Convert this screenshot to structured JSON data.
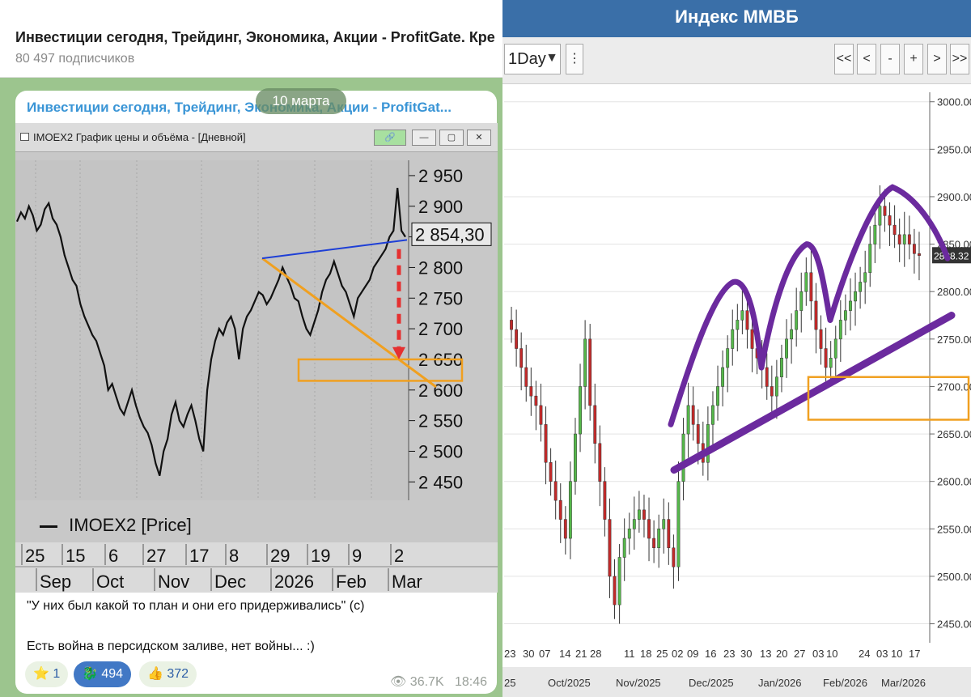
{
  "telegram": {
    "header_title": "Инвестиции сегодня, Трейдинг, Экономика, Акции - ProfitGate. Кре",
    "subscribers": "80 497 подписчиков",
    "channel_name": "Инвестиции сегодня, Трейдинг, Экономика, Акции - ProfitGat...",
    "date_pill": "10 марта",
    "window_title": "IMOEX2 График цены и объёма - [Дневной]",
    "text_line1": "\"У них был какой то план и они его придерживались\" (с)",
    "text_line2": "Есть война в персидском заливе, нет войны... :)",
    "reactions": [
      {
        "emoji": "⭐",
        "count": "1"
      },
      {
        "emoji": "🐉",
        "count": "494"
      },
      {
        "emoji": "👍",
        "count": "372"
      }
    ],
    "views": "36.7K",
    "time": "18:46"
  },
  "right_panel": {
    "title": "Индекс ММВБ",
    "period": "1Day",
    "nav_buttons": [
      "<<",
      "<",
      "-",
      "+",
      ">",
      ">>"
    ]
  },
  "chart_data": [
    {
      "type": "line",
      "title": "",
      "legend": "IMOEX2 [Price]",
      "y_ticks": [
        "2 950",
        "2 900",
        "2 850",
        "2 800",
        "2 750",
        "2 700",
        "2 650",
        "2 600",
        "2 550",
        "2 500",
        "2 450"
      ],
      "ylim": [
        2420,
        2975
      ],
      "last_price_label": "2 854,30",
      "x_day_labels": [
        "25",
        "15",
        "6",
        "27",
        "17",
        "8",
        "29",
        "19",
        "9",
        "2"
      ],
      "x_month_labels": [
        "Sep",
        "Oct",
        "Nov",
        "Dec",
        "2026",
        "Feb",
        "Mar"
      ],
      "series": [
        {
          "values": [
            2875,
            2890,
            2880,
            2900,
            2885,
            2860,
            2870,
            2895,
            2905,
            2880,
            2870,
            2850,
            2820,
            2800,
            2780,
            2770,
            2740,
            2720,
            2705,
            2690,
            2680,
            2660,
            2640,
            2600,
            2610,
            2590,
            2570,
            2560,
            2580,
            2600,
            2575,
            2555,
            2540,
            2530,
            2510,
            2480,
            2460,
            2500,
            2520,
            2560,
            2580,
            2550,
            2540,
            2560,
            2575,
            2550,
            2520,
            2500,
            2600,
            2650,
            2680,
            2700,
            2690,
            2710,
            2720,
            2700,
            2650,
            2700,
            2720,
            2730,
            2745,
            2760,
            2755,
            2740,
            2750,
            2765,
            2780,
            2800,
            2785,
            2770,
            2750,
            2745,
            2720,
            2700,
            2690,
            2710,
            2730,
            2760,
            2780,
            2790,
            2810,
            2790,
            2770,
            2760,
            2740,
            2720,
            2750,
            2760,
            2770,
            2780,
            2800,
            2810,
            2820,
            2830,
            2850,
            2860,
            2930,
            2860,
            2850
          ]
        }
      ],
      "annotations": {
        "resistance_line": {
          "color": "#1e3fd6"
        },
        "support_line": {
          "color": "#f0a020"
        },
        "target_box": {
          "y_range": [
            2615,
            2650
          ],
          "color": "#f0a020"
        },
        "arrow": {
          "color": "#e53030"
        }
      }
    },
    {
      "type": "candlestick",
      "title": "Индекс ММВБ",
      "y_ticks": [
        "3000.00",
        "2950.00",
        "2900.00",
        "2850.00",
        "2800.00",
        "2750.00",
        "2700.00",
        "2650.00",
        "2600.00",
        "2550.00",
        "2500.00",
        "2450.00"
      ],
      "ylim": [
        2430,
        3010
      ],
      "last_price_label": "2838.32",
      "x_day_labels": [
        "23",
        "30",
        "07",
        "14",
        "21",
        "28",
        "11",
        "18",
        "25",
        "02",
        "09",
        "16",
        "23",
        "30",
        "13",
        "20",
        "27",
        "03",
        "10",
        "24",
        "03",
        "10",
        "17"
      ],
      "x_month_labels": [
        "25",
        "Oct/2025",
        "Nov/2025",
        "Dec/2025",
        "Jan/2026",
        "Feb/2026",
        "Mar/2026"
      ],
      "closes": [
        2760,
        2740,
        2720,
        2700,
        2690,
        2680,
        2660,
        2620,
        2600,
        2580,
        2560,
        2540,
        2600,
        2650,
        2700,
        2750,
        2680,
        2640,
        2600,
        2560,
        2500,
        2470,
        2520,
        2540,
        2550,
        2560,
        2570,
        2560,
        2540,
        2530,
        2550,
        2560,
        2530,
        2510,
        2600,
        2650,
        2680,
        2660,
        2640,
        2620,
        2660,
        2680,
        2700,
        2720,
        2740,
        2760,
        2770,
        2780,
        2760,
        2740,
        2730,
        2720,
        2700,
        2690,
        2710,
        2730,
        2750,
        2760,
        2780,
        2800,
        2820,
        2790,
        2760,
        2740,
        2720,
        2730,
        2750,
        2770,
        2780,
        2790,
        2800,
        2810,
        2820,
        2850,
        2870,
        2890,
        2880,
        2870,
        2860,
        2850,
        2860,
        2850,
        2840,
        2838
      ],
      "annotations": {
        "trendline": {
          "color": "#6b2a9e"
        },
        "target_box": {
          "y_range": [
            2665,
            2710
          ],
          "color": "#f0a020"
        },
        "arcs_color": "#6b2a9e"
      }
    }
  ]
}
